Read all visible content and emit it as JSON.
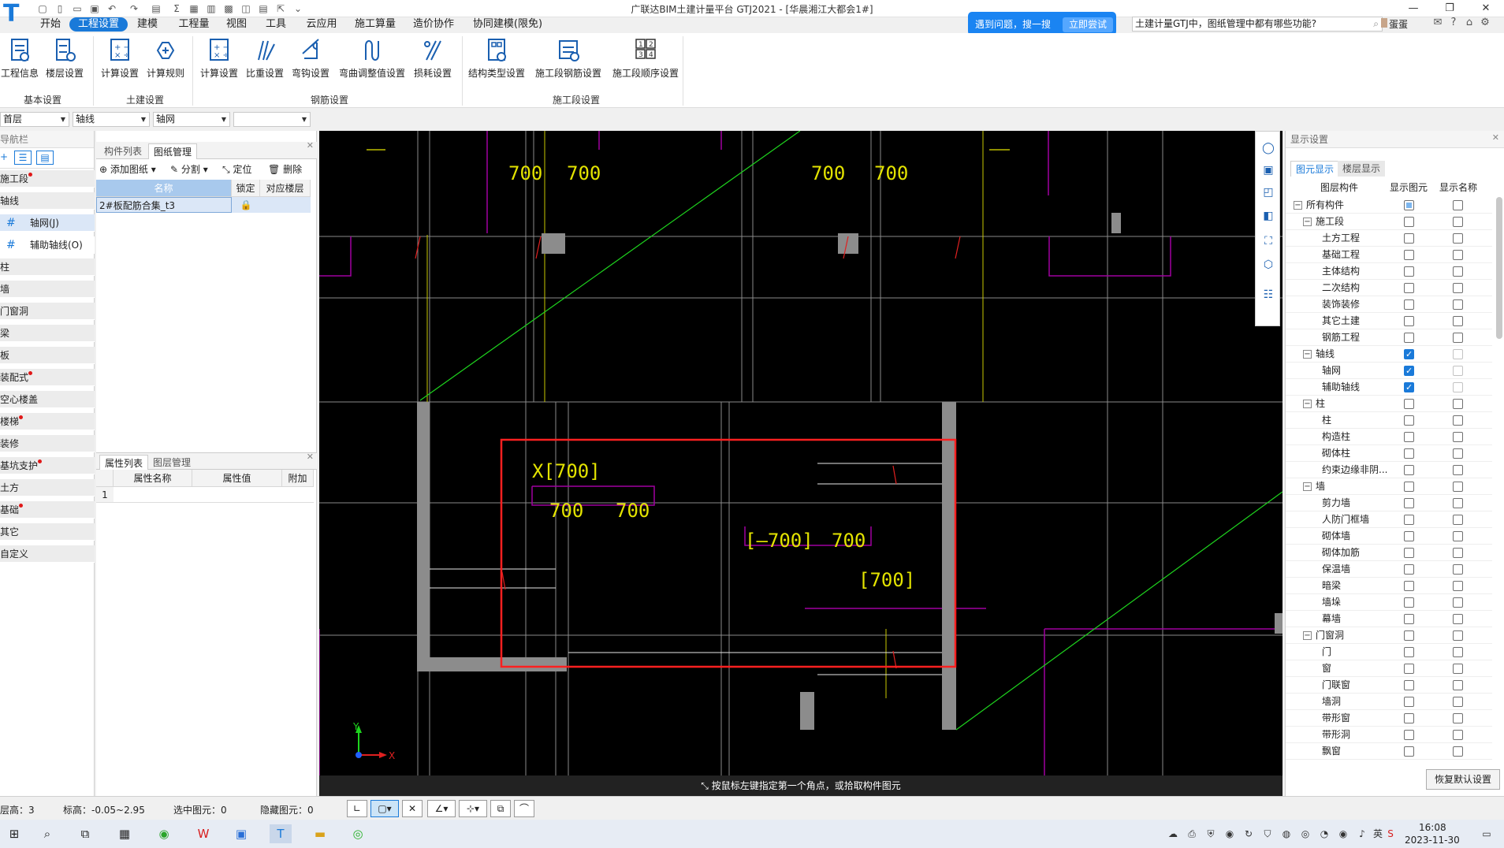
{
  "window": {
    "title": "广联达BIM土建计量平台 GTJ2021 - [华晨湘江大都会1#]",
    "logo": "T"
  },
  "menu": {
    "tabs": [
      {
        "label": "开始",
        "active": false
      },
      {
        "label": "工程设置",
        "active": true
      },
      {
        "label": "建模",
        "active": false
      },
      {
        "label": "工程量",
        "active": false
      },
      {
        "label": "视图",
        "active": false
      },
      {
        "label": "工具",
        "active": false
      },
      {
        "label": "云应用",
        "active": false
      },
      {
        "label": "施工算量",
        "active": false
      },
      {
        "label": "造价协作",
        "active": false
      },
      {
        "label": "协同建模(限免)",
        "active": false
      }
    ]
  },
  "help": {
    "prompt": "遇到问题，搜一搜",
    "try_label": "立即尝试",
    "search_text": "土建计量GTJ中，图纸管理中都有哪些功能?",
    "user_name": "蛋蛋"
  },
  "ribbon": {
    "groups": [
      "基本设置",
      "土建设置",
      "钢筋设置",
      "施工段设置"
    ],
    "buttons": [
      {
        "label": "工程信息"
      },
      {
        "label": "楼层设置"
      },
      {
        "label": "计算设置"
      },
      {
        "label": "计算规则"
      },
      {
        "label": "计算设置"
      },
      {
        "label": "比重设置"
      },
      {
        "label": "弯钩设置"
      },
      {
        "label": "弯曲调整值设置"
      },
      {
        "label": "损耗设置"
      },
      {
        "label": "结构类型设置"
      },
      {
        "label": "施工段钢筋设置"
      },
      {
        "label": "施工段顺序设置"
      }
    ]
  },
  "selectors": {
    "floor": "首层",
    "category": "轴线",
    "type": "轴网",
    "extra": ""
  },
  "leftnav": {
    "title": "导航栏",
    "items": [
      {
        "label": "施工段",
        "dot": true,
        "sub": false
      },
      {
        "label": "轴线",
        "dot": false,
        "sub": false
      },
      {
        "label": "轴网(J)",
        "dot": false,
        "sub": true,
        "selected": true,
        "icon": "grid-icon"
      },
      {
        "label": "辅助轴线(O)",
        "dot": false,
        "sub": true,
        "selected": false,
        "icon": "aux-grid-icon"
      },
      {
        "label": "柱",
        "dot": false,
        "sub": false
      },
      {
        "label": "墙",
        "dot": false,
        "sub": false
      },
      {
        "label": "门窗洞",
        "dot": false,
        "sub": false
      },
      {
        "label": "梁",
        "dot": false,
        "sub": false
      },
      {
        "label": "板",
        "dot": false,
        "sub": false
      },
      {
        "label": "装配式",
        "dot": true,
        "sub": false
      },
      {
        "label": "空心楼盖",
        "dot": false,
        "sub": false
      },
      {
        "label": "楼梯",
        "dot": true,
        "sub": false
      },
      {
        "label": "装修",
        "dot": false,
        "sub": false
      },
      {
        "label": "基坑支护",
        "dot": true,
        "sub": false
      },
      {
        "label": "土方",
        "dot": false,
        "sub": false
      },
      {
        "label": "基础",
        "dot": true,
        "sub": false
      },
      {
        "label": "其它",
        "dot": false,
        "sub": false
      },
      {
        "label": "自定义",
        "dot": false,
        "sub": false
      }
    ]
  },
  "drawing_panel": {
    "tabs": [
      "构件列表",
      "图纸管理"
    ],
    "tools": [
      "添加图纸",
      "分割",
      "定位",
      "删除"
    ],
    "columns": [
      "名称",
      "锁定",
      "对应楼层"
    ],
    "rows": [
      {
        "name": "2#板配筋合集_t3",
        "floor": ""
      }
    ]
  },
  "property_panel": {
    "tabs": [
      "属性列表",
      "图层管理"
    ],
    "columns": [
      "属性名称",
      "属性值",
      "附加"
    ],
    "rows": [
      {
        "index": "1",
        "name": "",
        "value": ""
      }
    ]
  },
  "canvas": {
    "status_message": "按鼠标左键指定第一个角点，或拾取构件图元",
    "labels_top": [
      "700",
      "700",
      "700",
      "700"
    ],
    "labels_mid": [
      "X[700]",
      "700",
      "700",
      "[—700]",
      "700",
      "[700]"
    ],
    "axis_x": "X",
    "axis_y": "Y"
  },
  "display_settings": {
    "title": "显示设置",
    "tabs": [
      "图元显示",
      "楼层显示"
    ],
    "columns": [
      "图层构件",
      "显示图元",
      "显示名称"
    ],
    "restore_label": "恢复默认设置",
    "rows": [
      {
        "label": "所有构件",
        "level": 0,
        "toggle": "−",
        "show": "partial",
        "name": "off"
      },
      {
        "label": "施工段",
        "level": 1,
        "toggle": "−",
        "show": "off",
        "name": "off"
      },
      {
        "label": "土方工程",
        "level": 2,
        "show": "off",
        "name": "off"
      },
      {
        "label": "基础工程",
        "level": 2,
        "show": "off",
        "name": "off"
      },
      {
        "label": "主体结构",
        "level": 2,
        "show": "off",
        "name": "off"
      },
      {
        "label": "二次结构",
        "level": 2,
        "show": "off",
        "name": "off"
      },
      {
        "label": "装饰装修",
        "level": 2,
        "show": "off",
        "name": "off"
      },
      {
        "label": "其它土建",
        "level": 2,
        "show": "off",
        "name": "off"
      },
      {
        "label": "钢筋工程",
        "level": 2,
        "show": "off",
        "name": "off"
      },
      {
        "label": "轴线",
        "level": 1,
        "toggle": "−",
        "show": "on",
        "name": "dis"
      },
      {
        "label": "轴网",
        "level": 2,
        "show": "on",
        "name": "dis"
      },
      {
        "label": "辅助轴线",
        "level": 2,
        "show": "on",
        "name": "dis"
      },
      {
        "label": "柱",
        "level": 1,
        "toggle": "−",
        "show": "off",
        "name": "off"
      },
      {
        "label": "柱",
        "level": 2,
        "show": "off",
        "name": "off"
      },
      {
        "label": "构造柱",
        "level": 2,
        "show": "off",
        "name": "off"
      },
      {
        "label": "砌体柱",
        "level": 2,
        "show": "off",
        "name": "off"
      },
      {
        "label": "约束边缘非阴...",
        "level": 2,
        "show": "off",
        "name": "off"
      },
      {
        "label": "墙",
        "level": 1,
        "toggle": "−",
        "show": "off",
        "name": "off"
      },
      {
        "label": "剪力墙",
        "level": 2,
        "show": "off",
        "name": "off"
      },
      {
        "label": "人防门框墙",
        "level": 2,
        "show": "off",
        "name": "off"
      },
      {
        "label": "砌体墙",
        "level": 2,
        "show": "off",
        "name": "off"
      },
      {
        "label": "砌体加筋",
        "level": 2,
        "show": "off",
        "name": "off"
      },
      {
        "label": "保温墙",
        "level": 2,
        "show": "off",
        "name": "off"
      },
      {
        "label": "暗梁",
        "level": 2,
        "show": "off",
        "name": "off"
      },
      {
        "label": "墙垛",
        "level": 2,
        "show": "off",
        "name": "off"
      },
      {
        "label": "幕墙",
        "level": 2,
        "show": "off",
        "name": "off"
      },
      {
        "label": "门窗洞",
        "level": 1,
        "toggle": "−",
        "show": "off",
        "name": "off"
      },
      {
        "label": "门",
        "level": 2,
        "show": "off",
        "name": "off"
      },
      {
        "label": "窗",
        "level": 2,
        "show": "off",
        "name": "off"
      },
      {
        "label": "门联窗",
        "level": 2,
        "show": "off",
        "name": "off"
      },
      {
        "label": "墙洞",
        "level": 2,
        "show": "off",
        "name": "off"
      },
      {
        "label": "带形窗",
        "level": 2,
        "show": "off",
        "name": "off"
      },
      {
        "label": "带形洞",
        "level": 2,
        "show": "off",
        "name": "off"
      },
      {
        "label": "飘窗",
        "level": 2,
        "show": "off",
        "name": "off"
      }
    ]
  },
  "statusbar": {
    "floor_height": "层高：3",
    "elevation": "标高：-0.05~2.95",
    "selected": "选中图元：0",
    "hidden": "隐藏图元：0"
  },
  "taskbar": {
    "time": "16:08",
    "date": "2023-11-30",
    "ime": "英"
  }
}
